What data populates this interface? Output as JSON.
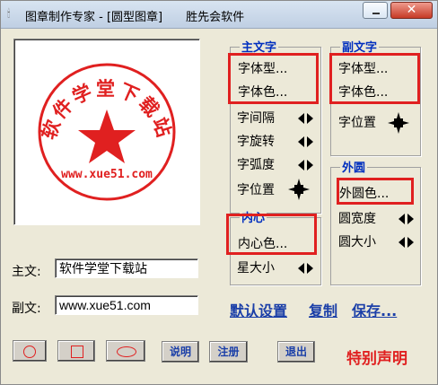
{
  "window": {
    "title": "图章制作专家 - [圆型图章]　　胜先会软件"
  },
  "seal": {
    "main_text": "软件学堂下载站",
    "sub_text": "www.xue51.com",
    "color": "#e02020"
  },
  "form": {
    "main_label": "主文:",
    "main_value": "软件学堂下载站",
    "sub_label": "副文:",
    "sub_value": "www.xue51.com"
  },
  "groups": {
    "main_text_title": "主文字",
    "sub_text_title": "副文字",
    "inner_title": "内心",
    "outer_title": "外圆"
  },
  "main_text": {
    "font_type": "字体型...",
    "font_color": "字体色...",
    "spacing": "字间隔",
    "rotation": "字旋转",
    "arc": "字弧度",
    "position": "字位置"
  },
  "sub_text": {
    "font_type": "字体型...",
    "font_color": "字体色...",
    "position": "字位置"
  },
  "inner": {
    "color": "内心色...",
    "star_size": "星大小"
  },
  "outer": {
    "color": "外圆色...",
    "width": "圆宽度",
    "size": "圆大小"
  },
  "links": {
    "default": "默认设置",
    "copy": "复制",
    "save": "保存..."
  },
  "buttons": {
    "help": "说明",
    "register": "注册",
    "exit": "退出"
  },
  "notice": "特别声明",
  "colors": {
    "accent_blue": "#1b3fa8",
    "highlight_red": "#e02020"
  }
}
